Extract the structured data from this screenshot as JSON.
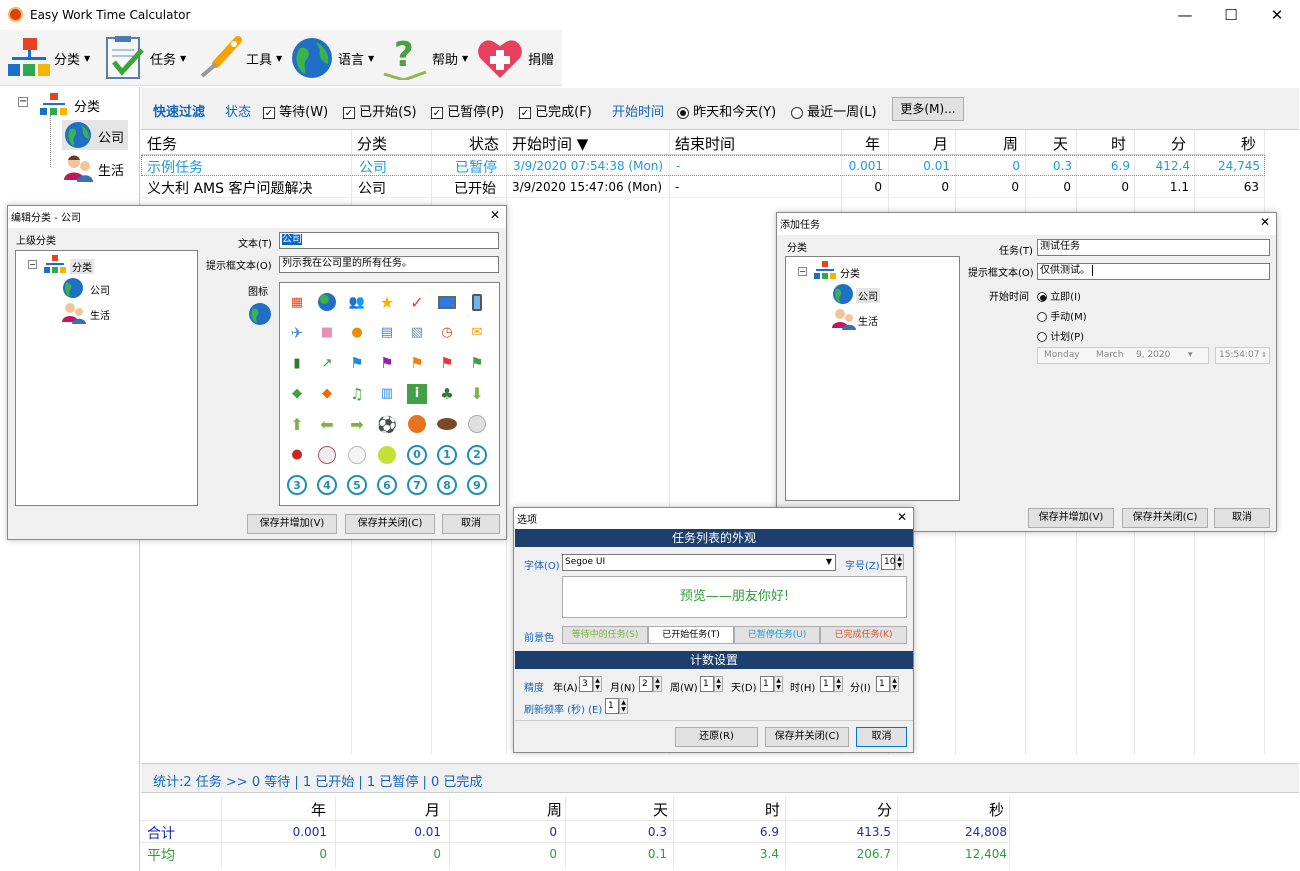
{
  "window": {
    "title": "Easy Work Time Calculator",
    "minimize": "—",
    "maximize": "☐",
    "close": "✕"
  },
  "toolbar": [
    {
      "label": "分类"
    },
    {
      "label": "任务"
    },
    {
      "label": "工具"
    },
    {
      "label": "语言"
    },
    {
      "label": "帮助"
    },
    {
      "label": "捐赠"
    }
  ],
  "tree": {
    "root": "分类",
    "children": [
      "公司",
      "生活"
    ]
  },
  "filter": {
    "title": "快速过滤",
    "status": "状态",
    "waiting": "等待(W)",
    "started": "已开始(S)",
    "paused": "已暂停(P)",
    "finished": "已完成(F)",
    "start_time": "开始时间",
    "yesterday_today": "昨天和今天(Y)",
    "last_week": "最近一周(L)",
    "more": "更多(M)..."
  },
  "grid": {
    "headers": {
      "task": "任务",
      "category": "分类",
      "status": "状态",
      "start": "开始时间 ▼",
      "end": "结束时间",
      "year": "年",
      "month": "月",
      "week": "周",
      "day": "天",
      "hour": "时",
      "minute": "分",
      "second": "秒"
    },
    "rows": [
      {
        "task": "示例任务",
        "category": "公司",
        "status": "已暂停",
        "start": "3/9/2020 07:54:38 (Mon)",
        "end": "-",
        "year": "0.001",
        "month": "0.01",
        "week": "0",
        "day": "0.3",
        "hour": "6.9",
        "minute": "412.4",
        "second": "24,745"
      },
      {
        "task": "义大利 AMS 客户问题解决",
        "category": "公司",
        "status": "已开始",
        "start": "3/9/2020 15:47:06 (Mon)",
        "end": "-",
        "year": "0",
        "month": "0",
        "week": "0",
        "day": "0",
        "hour": "0",
        "minute": "1.1",
        "second": "63"
      }
    ]
  },
  "edit_dialog": {
    "title": "编辑分类 - 公司",
    "parent": "上级分类",
    "text_label": "文本(T)",
    "text_value": "公司",
    "tip_label": "提示框文本(O)",
    "tip_value": "列示我在公司里的所有任务。",
    "icon_label": "图标",
    "ring_numbers": [
      "0",
      "1",
      "2",
      "3",
      "4",
      "5",
      "6",
      "7",
      "8",
      "9"
    ],
    "save_add": "保存并增加(V)",
    "save_close": "保存并关闭(C)",
    "cancel": "取消"
  },
  "add_dialog": {
    "title": "添加任务",
    "category": "分类",
    "task_label": "任务(T)",
    "task_value": "测试任务",
    "tip_label": "提示框文本(O)",
    "tip_value": "仅供测试。",
    "start_label": "开始时间",
    "opt_now": "立即(I)",
    "opt_manual": "手动(M)",
    "opt_plan": "计划(P)",
    "date_day": "Monday",
    "date_month": "March",
    "date_day_num": "9, 2020",
    "time_value": "15:54:07",
    "save_add": "保存并增加(V)",
    "save_close": "保存并关闭(C)",
    "cancel": "取消"
  },
  "options_dialog": {
    "title": "选项",
    "section1": "任务列表的外观",
    "font_label": "字体(O)",
    "font_value": "Segoe UI",
    "size_label": "字号(Z)",
    "size_value": "10",
    "preview": "预览——朋友你好!",
    "fg_label": "前景色",
    "fg_waiting": "等待中的任务(S)",
    "fg_started": "已开始任务(T)",
    "fg_paused": "已暂停任务(U)",
    "fg_finished": "已完成任务(K)",
    "section2": "计数设置",
    "precision": "精度",
    "year": "年(A)",
    "year_v": "3",
    "month": "月(N)",
    "month_v": "2",
    "week": "周(W)",
    "week_v": "1",
    "day": "天(D)",
    "day_v": "1",
    "hour": "时(H)",
    "hour_v": "1",
    "minute": "分(I)",
    "minute_v": "1",
    "refresh": "刷新频率 (秒) (E)",
    "refresh_v": "1",
    "restore": "还原(R)",
    "save_close": "保存并关闭(C)",
    "cancel": "取消"
  },
  "status": {
    "text": "统计:2 任务 >> 0 等待 | 1 已开始 | 1 已暂停 | 0 已完成"
  },
  "summary": {
    "headers": [
      "年",
      "月",
      "周",
      "天",
      "时",
      "分",
      "秒"
    ],
    "total_label": "合计",
    "total": [
      "0.001",
      "0.01",
      "0",
      "0.3",
      "6.9",
      "413.5",
      "24,808"
    ],
    "avg_label": "平均",
    "avg": [
      "0",
      "0",
      "0",
      "0.1",
      "3.4",
      "206.7",
      "12,404"
    ]
  },
  "colors": {
    "accent": "#1565c0",
    "paused": "#1e9bd7",
    "waiting": "#2e9e3a",
    "finished": "#e0522d",
    "header": "#1d3f6e"
  }
}
